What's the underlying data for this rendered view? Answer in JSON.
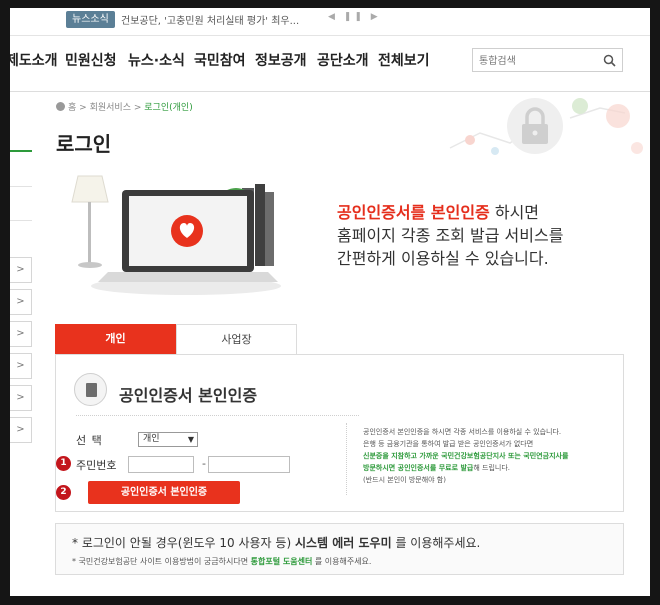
{
  "news": {
    "badge": "뉴스소식",
    "headline": "건보공단, '고충민원 처리실태 평가' 최우...",
    "controls": "◀ ❚❚ ▶"
  },
  "gnb": {
    "items": [
      "제도소개",
      "민원신청",
      "뉴스·소식",
      "국민참여",
      "정보공개",
      "공단소개",
      "전체보기"
    ]
  },
  "search": {
    "placeholder": "통합검색"
  },
  "breadcrumb": {
    "home": "홈",
    "sep": ">",
    "section": "회원서비스",
    "current": "로그인(개인)"
  },
  "page_title": "로그인",
  "hero": {
    "highlight": "공인인증서를 본인인증",
    "line1_rest": " 하시면",
    "line2": "홈페이지 각종 조회 발급 서비스를",
    "line3": "간편하게 이용하실 수 있습니다."
  },
  "tabs": {
    "personal": "개인",
    "business": "사업장"
  },
  "cert": {
    "title": "공인인증서 본인인증",
    "select_label": "선    택",
    "select_value": "개인",
    "rrn_label": "주민번호",
    "dash": "-",
    "step1": "1",
    "step2": "2",
    "button": "공인인증서 본인인증"
  },
  "info": {
    "line1": "공인인증서 본인인증을 하시면 각종 서비스를 이용하실 수 있습니다.",
    "line2": "은행 등 금융기관을 통하여 발급 받은 공인인증서가 없다면",
    "line3": "신분증을 지참하고 가까운 국민건강보험공단지사 또는 국민연금지사를",
    "line4a": "방문하시면 공인인증서를 무료로 발급",
    "line4b": "해 드립니다.",
    "line5": "(반드시 본인이 방문해야 함)"
  },
  "notice": {
    "line1a": "* 로그인이 안될 경우(윈도우 10 사용자 등) ",
    "line1b": "시스템 에러 도우미",
    "line1c": " 를 이용해주세요.",
    "line2a": "* 국민건강보험공단 사이트 이용방법이 궁금하시다면 ",
    "line2b": "통합포털 도움센터",
    "line2c": " 를 이용해주세요."
  },
  "sidebar": {
    "arrow": ">"
  },
  "colors": {
    "accent_red": "#e8321d",
    "accent_green": "#2d9a3b",
    "badge_blue": "#5b7f96"
  }
}
